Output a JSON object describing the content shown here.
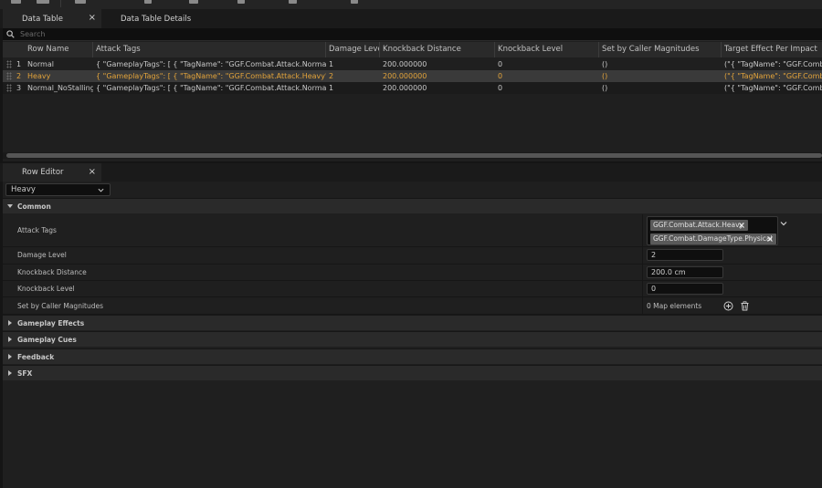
{
  "tabs": [
    {
      "label": "Data Table",
      "close": "×"
    },
    {
      "label": "Data Table Details"
    }
  ],
  "search": {
    "placeholder": "Search"
  },
  "table": {
    "columns": [
      "Row Name",
      "Attack Tags",
      "Damage Level",
      "Knockback Distance",
      "Knockback Level",
      "Set by Caller Magnitudes",
      "Target Effect Per Impact"
    ],
    "rows": [
      {
        "index": "1",
        "name": "Normal",
        "attack_tags": "{ \"GameplayTags\": [ { \"TagName\": \"GGF.Combat.Attack.Normal\" }, { \"T",
        "damage_level": "1",
        "knockback_distance": "200.000000",
        "knockback_level": "0",
        "set_by_caller": "()",
        "target_effect": "(\"{ \"TagName\": \"GGF.Combat."
      },
      {
        "index": "2",
        "name": "Heavy",
        "attack_tags": "{ \"GameplayTags\": [ { \"TagName\": \"GGF.Combat.Attack.Heavy\" }, { \"Ta",
        "damage_level": "2",
        "knockback_distance": "200.000000",
        "knockback_level": "0",
        "set_by_caller": "()",
        "target_effect": "(\"{ \"TagName\": \"GGF.Combat."
      },
      {
        "index": "3",
        "name": "Normal_NoStalling",
        "attack_tags": "{ \"GameplayTags\": [ { \"TagName\": \"GGF.Combat.Attack.Normal\" }, { \"T",
        "damage_level": "1",
        "knockback_distance": "200.000000",
        "knockback_level": "0",
        "set_by_caller": "()",
        "target_effect": "(\"{ \"TagName\": \"GGF.Combat."
      }
    ]
  },
  "row_editor": {
    "tab_label": "Row Editor",
    "tab_close": "×",
    "selected_row": "Heavy",
    "categories": {
      "common": "Common",
      "gameplay_effects": "Gameplay Effects",
      "gameplay_cues": "Gameplay Cues",
      "feedback": "Feedback",
      "sfx": "SFX"
    },
    "props": {
      "attack_tags_label": "Attack Tags",
      "attack_tags": [
        "GGF.Combat.Attack.Heavy",
        "GGF.Combat.DamageType.Physical"
      ],
      "damage_level_label": "Damage Level",
      "damage_level": "2",
      "knockback_distance_label": "Knockback Distance",
      "knockback_distance": "200.0 cm",
      "knockback_level_label": "Knockback Level",
      "knockback_level": "0",
      "set_by_caller_label": "Set by Caller Magnitudes",
      "set_by_caller_value": "0 Map elements"
    }
  },
  "colors": {
    "selected_text": "#e2a33a",
    "background": "#1f1f1f",
    "header": "#2a2a2a"
  }
}
